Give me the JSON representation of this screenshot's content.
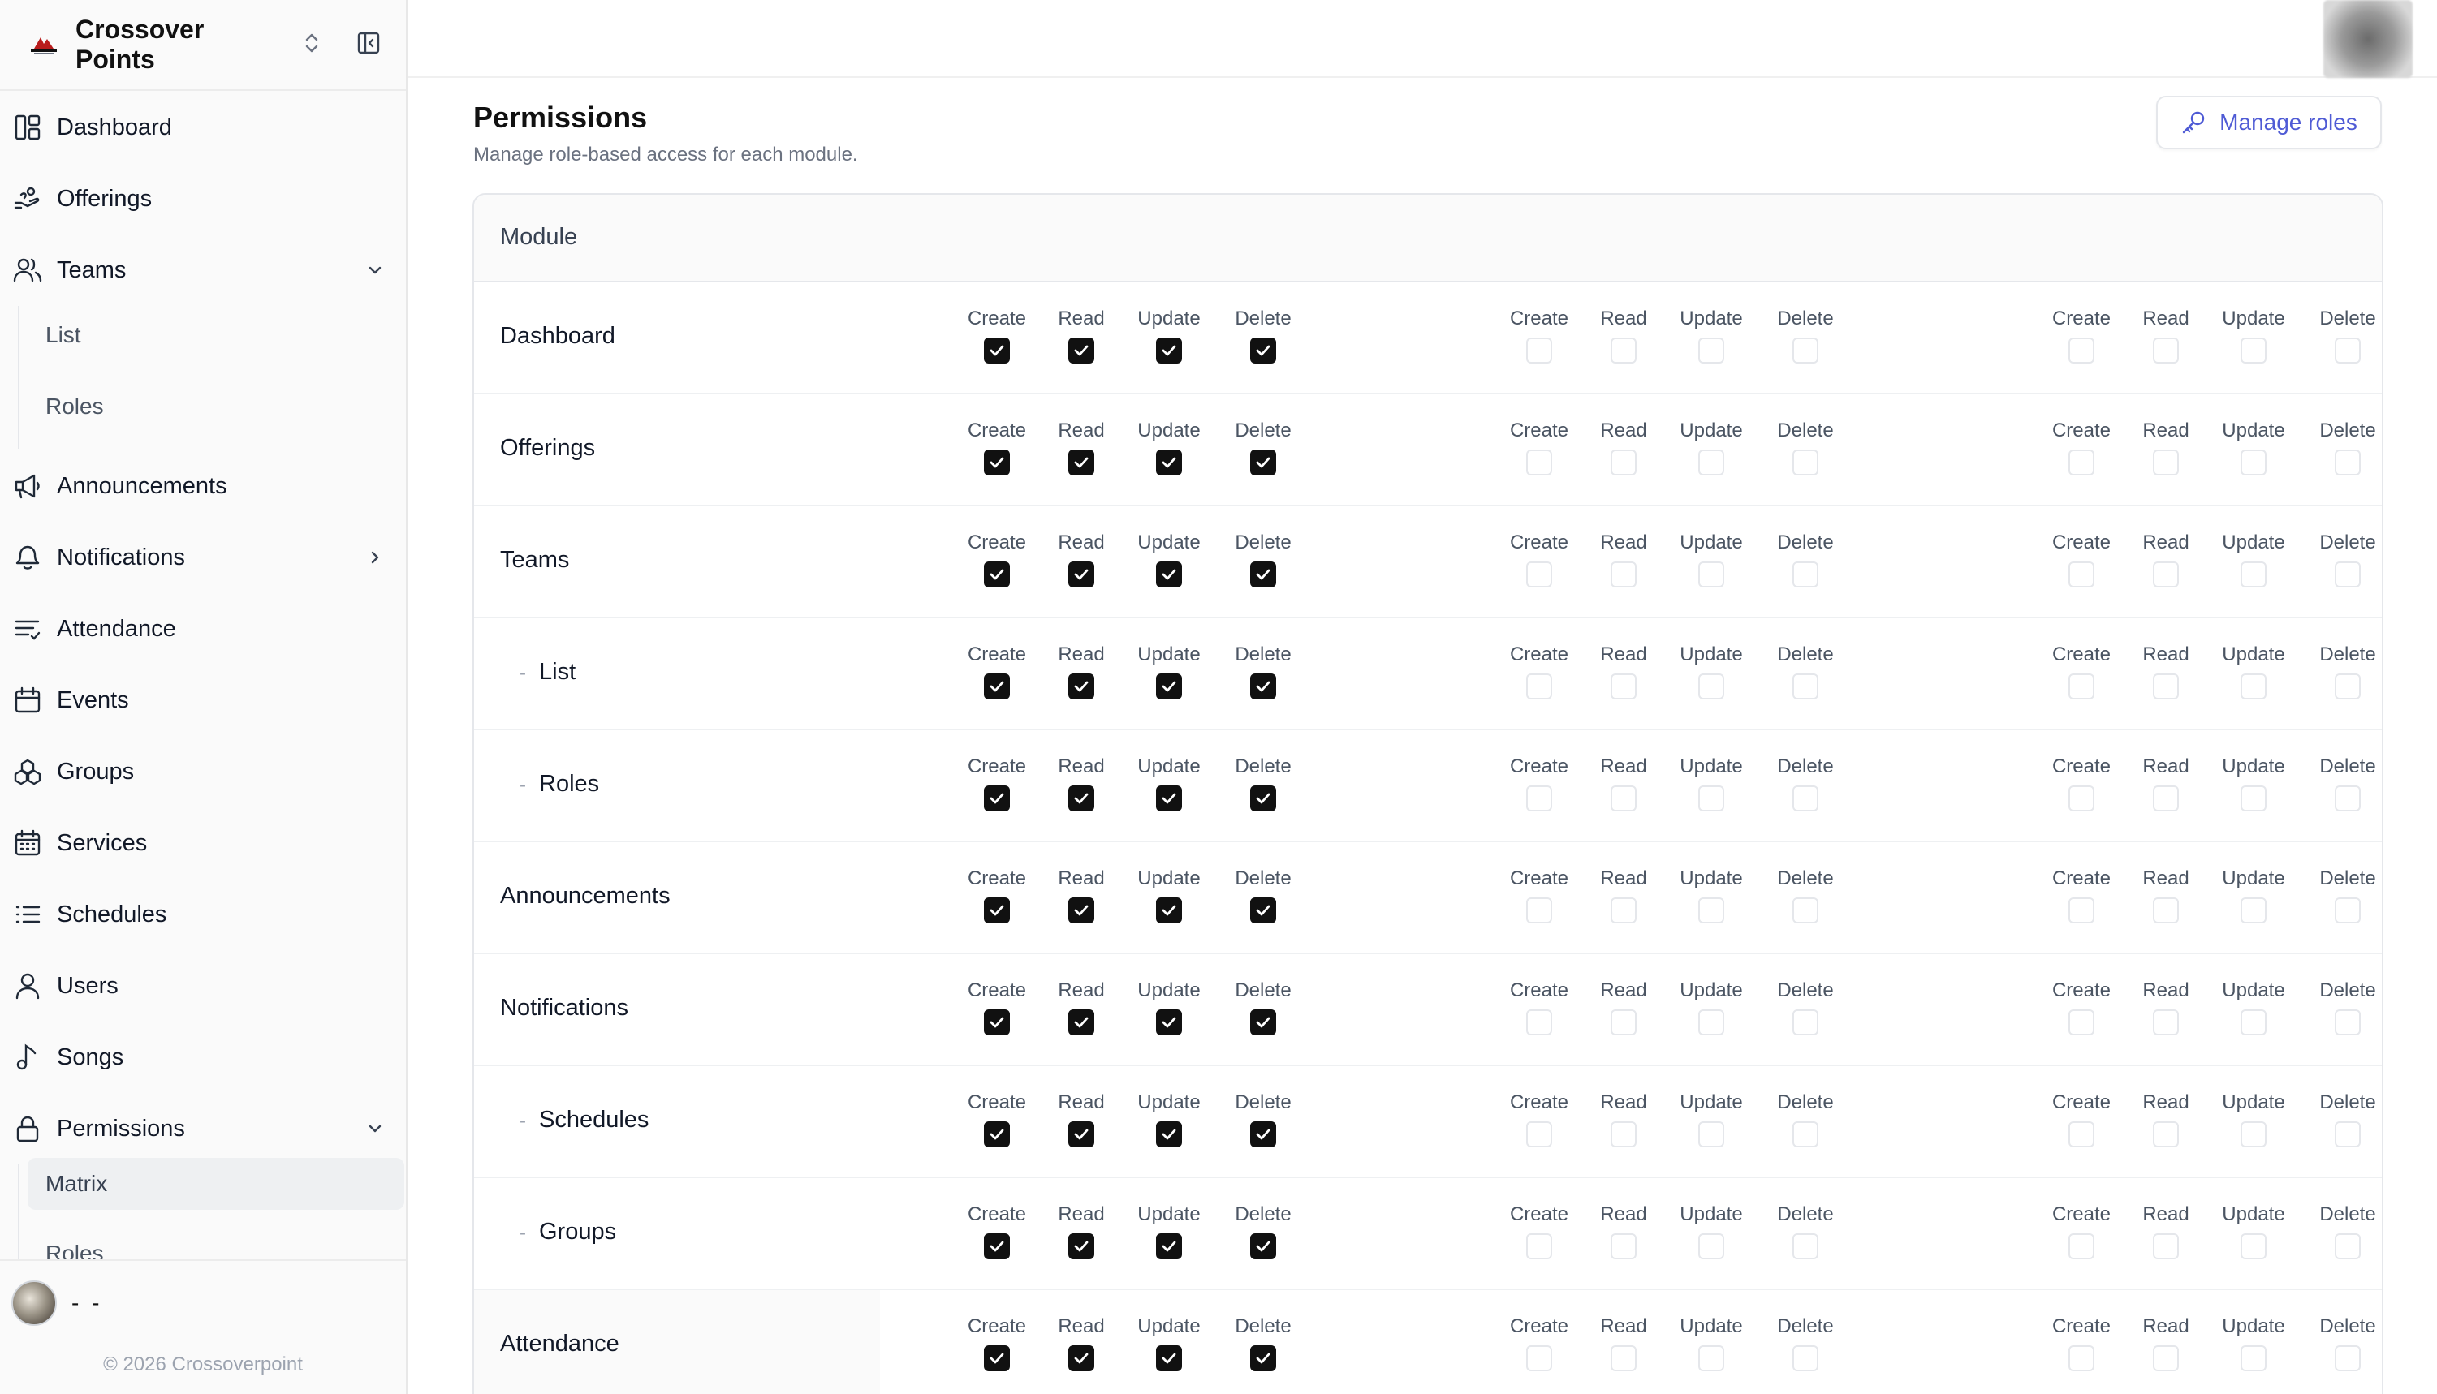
{
  "brand": {
    "name": "Crossover Points"
  },
  "sidebar": {
    "items": [
      {
        "label": "Dashboard",
        "icon": "dashboard-icon"
      },
      {
        "label": "Offerings",
        "icon": "offerings-icon"
      },
      {
        "label": "Teams",
        "icon": "users-icon",
        "chevron": "down"
      },
      {
        "label": "Announcements",
        "icon": "megaphone-icon"
      },
      {
        "label": "Notifications",
        "icon": "bell-icon",
        "chevron": "right"
      },
      {
        "label": "Attendance",
        "icon": "list-filter-icon"
      },
      {
        "label": "Events",
        "icon": "calendar-icon"
      },
      {
        "label": "Groups",
        "icon": "groups-icon"
      },
      {
        "label": "Services",
        "icon": "calendar-grid-icon"
      },
      {
        "label": "Schedules",
        "icon": "list-icon"
      },
      {
        "label": "Users",
        "icon": "user-icon"
      },
      {
        "label": "Songs",
        "icon": "music-note-icon"
      },
      {
        "label": "Permissions",
        "icon": "lock-icon",
        "chevron": "down"
      }
    ],
    "teams_sub": [
      "List",
      "Roles"
    ],
    "permissions_sub": [
      "Matrix",
      "Roles"
    ],
    "active_sub": "Matrix"
  },
  "footer": {
    "user_name": "- -",
    "copyright": "© 2026 Crossoverpoint"
  },
  "page": {
    "title": "Permissions",
    "subtitle": "Manage role-based access for each module.",
    "manage_roles": "Manage roles"
  },
  "table": {
    "header": "Module",
    "actions": [
      "Create",
      "Read",
      "Update",
      "Delete"
    ],
    "rows": [
      {
        "name": "Dashboard",
        "sub": false,
        "groups": [
          [
            true,
            true,
            true,
            true
          ],
          [
            false,
            false,
            false,
            false
          ],
          [
            false,
            false,
            false,
            false
          ]
        ]
      },
      {
        "name": "Offerings",
        "sub": false,
        "groups": [
          [
            true,
            true,
            true,
            true
          ],
          [
            false,
            false,
            false,
            false
          ],
          [
            false,
            false,
            false,
            false
          ]
        ]
      },
      {
        "name": "Teams",
        "sub": false,
        "groups": [
          [
            true,
            true,
            true,
            true
          ],
          [
            false,
            false,
            false,
            false
          ],
          [
            false,
            false,
            false,
            false
          ]
        ]
      },
      {
        "name": "List",
        "sub": true,
        "groups": [
          [
            true,
            true,
            true,
            true
          ],
          [
            false,
            false,
            false,
            false
          ],
          [
            false,
            false,
            false,
            false
          ]
        ]
      },
      {
        "name": "Roles",
        "sub": true,
        "groups": [
          [
            true,
            true,
            true,
            true
          ],
          [
            false,
            false,
            false,
            false
          ],
          [
            false,
            false,
            false,
            false
          ]
        ]
      },
      {
        "name": "Announcements",
        "sub": false,
        "groups": [
          [
            true,
            true,
            true,
            true
          ],
          [
            false,
            false,
            false,
            false
          ],
          [
            false,
            false,
            false,
            false
          ]
        ]
      },
      {
        "name": "Notifications",
        "sub": false,
        "groups": [
          [
            true,
            true,
            true,
            true
          ],
          [
            false,
            false,
            false,
            false
          ],
          [
            false,
            false,
            false,
            false
          ]
        ]
      },
      {
        "name": "Schedules",
        "sub": true,
        "groups": [
          [
            true,
            true,
            true,
            true
          ],
          [
            false,
            false,
            false,
            false
          ],
          [
            false,
            false,
            false,
            false
          ]
        ]
      },
      {
        "name": "Groups",
        "sub": true,
        "groups": [
          [
            true,
            true,
            true,
            true
          ],
          [
            false,
            false,
            false,
            false
          ],
          [
            false,
            false,
            false,
            false
          ]
        ]
      },
      {
        "name": "Attendance",
        "sub": false,
        "groups": [
          [
            true,
            true,
            true,
            true
          ],
          [
            false,
            false,
            false,
            false
          ],
          [
            false,
            false,
            false,
            false
          ]
        ]
      }
    ]
  },
  "colors": {
    "accent": "#4f5bd5",
    "checked": "#111111",
    "border": "#e5e7eb",
    "muted": "#6b7280"
  }
}
